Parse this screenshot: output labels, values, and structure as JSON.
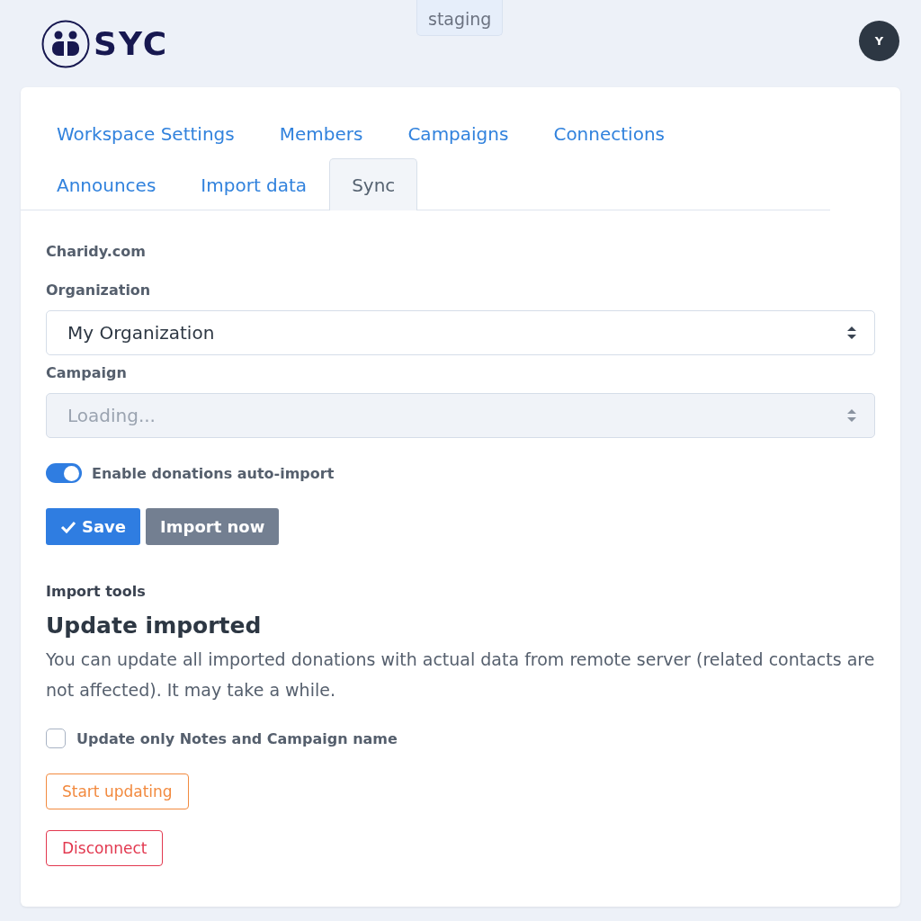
{
  "header": {
    "logo": "SYC",
    "environment": "staging",
    "avatar": "Y"
  },
  "tabs": [
    {
      "label": "Workspace Settings",
      "selected": false
    },
    {
      "label": "Members",
      "selected": false
    },
    {
      "label": "Campaigns",
      "selected": false
    },
    {
      "label": "Connections",
      "selected": false
    },
    {
      "label": "Announces",
      "selected": false
    },
    {
      "label": "Import data",
      "selected": false
    },
    {
      "label": "Sync",
      "selected": true
    }
  ],
  "section_title": "Charidy.com",
  "organization": {
    "label": "Organization",
    "value": "My Organization",
    "disabled": false
  },
  "campaign": {
    "label": "Campaign",
    "value": "Loading...",
    "disabled": true
  },
  "auto_import": {
    "label": "Enable donations auto-import",
    "on": true
  },
  "buttons": [
    {
      "label": "Save",
      "kind": "primary"
    },
    {
      "label": "Import now",
      "kind": "secondary"
    }
  ],
  "import_tools": {
    "label": "Import tools",
    "heading": "Update imported",
    "description": "You can update all imported donations with actual data from remote server (related contacts are not affected). It may take a while.",
    "checkbox": {
      "label": "Update only Notes and Campaign name",
      "checked": false
    },
    "start_button": "Start updating"
  },
  "disconnect_button": "Disconnect"
}
